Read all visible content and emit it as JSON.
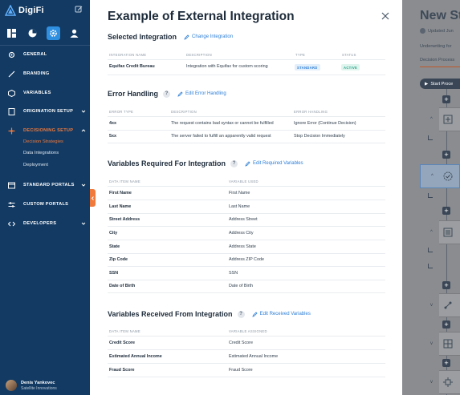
{
  "app": {
    "brand": "DigiFi"
  },
  "sidebar": {
    "items": [
      {
        "label": "GENERAL"
      },
      {
        "label": "BRANDING"
      },
      {
        "label": "VARIABLES"
      },
      {
        "label": "ORIGINATION SETUP"
      },
      {
        "label": "DECISIONING SETUP"
      },
      {
        "label": "STANDARD PORTALS"
      },
      {
        "label": "CUSTOM PORTALS"
      },
      {
        "label": "DEVELOPERS"
      }
    ],
    "sub_items": [
      "Decision Strategies",
      "Data Integrations",
      "Deployment"
    ],
    "user": {
      "name": "Denis Yankovec",
      "company": "Satellite Innovations"
    }
  },
  "modal": {
    "title": "Example of External Integration",
    "selected": {
      "title": "Selected Integration",
      "link": "Change Integration",
      "headers": [
        "INTEGRATION NAME",
        "DESCRIPTION",
        "TYPE",
        "STATUS"
      ],
      "row": {
        "name": "Equifax Credit Bureau",
        "description": "Integration with Equifax for custom scoring",
        "type": "STANDARD",
        "status": "ACTIVE"
      }
    },
    "errors": {
      "title": "Error Handling",
      "help": "?",
      "link": "Edit Error Handling",
      "headers": [
        "ERROR TYPE",
        "DESCRIPTION",
        "ERROR HANDLING"
      ],
      "rows": [
        {
          "type": "4xx",
          "description": "The request contains bad syntax or cannot be fulfilled",
          "handling": "Ignore Error (Continue Decision)"
        },
        {
          "type": "5xx",
          "description": "The server failed to fulfill an apparently valid request",
          "handling": "Stop Decision Immediately"
        }
      ]
    },
    "required": {
      "title": "Variables Required For Integration",
      "help": "?",
      "link": "Edit Required Variables",
      "headers": [
        "DATA ITEM NAME",
        "VARIABLE USED"
      ],
      "rows": [
        {
          "name": "First Name",
          "variable": "First Name"
        },
        {
          "name": "Last Name",
          "variable": "Last Name"
        },
        {
          "name": "Street Address",
          "variable": "Address Street"
        },
        {
          "name": "City",
          "variable": "Address City"
        },
        {
          "name": "State",
          "variable": "Address State"
        },
        {
          "name": "Zip Code",
          "variable": "Address ZIP Code"
        },
        {
          "name": "SSN",
          "variable": "SSN"
        },
        {
          "name": "Date of Birth",
          "variable": "Date of Birth"
        }
      ]
    },
    "received": {
      "title": "Variables Received From Integration",
      "help": "?",
      "link": "Edit Received Variables",
      "headers": [
        "DATA ITEM NAME",
        "VARIABLE ASSIGNED"
      ],
      "rows": [
        {
          "name": "Credit Score",
          "variable": "Credit Score"
        },
        {
          "name": "Estimated Annual Income",
          "variable": "Estimated Annual Income"
        },
        {
          "name": "Fraud Score",
          "variable": "Fraud Score"
        }
      ]
    }
  },
  "background": {
    "title": "New St",
    "updated": "Updated Jun",
    "underwriting": "Underwriting for",
    "tab": "Decision Process",
    "start": "Start Proce"
  },
  "colors": {
    "sidebar": "#123a63",
    "accent": "#f07a3c",
    "link": "#2d7ed6"
  }
}
